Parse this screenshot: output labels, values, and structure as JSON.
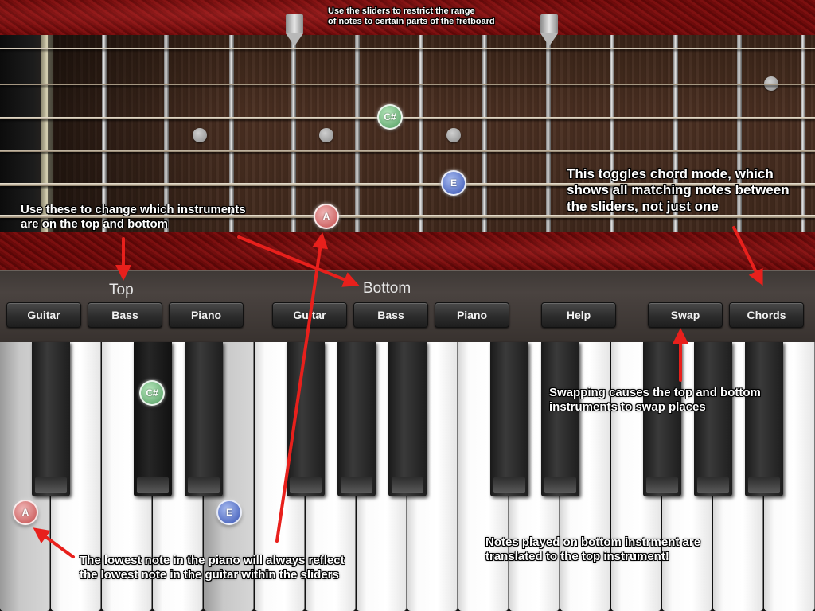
{
  "panel": {
    "top_group_label": "Top",
    "bottom_group_label": "Bottom",
    "top_buttons": [
      "Guitar",
      "Bass",
      "Piano"
    ],
    "bottom_buttons": [
      "Guitar",
      "Bass",
      "Piano"
    ],
    "help_label": "Help",
    "swap_label": "Swap",
    "chords_label": "Chords"
  },
  "notes": {
    "fret_csharp": "C#",
    "fret_e": "E",
    "fret_a": "A",
    "piano_csharp": "C#",
    "piano_e": "E",
    "piano_a": "A"
  },
  "annotations": {
    "sliders_line1": "Use the sliders to restrict the range",
    "sliders_line2": "of notes to certain parts of the fretboard",
    "instruments_line1": "Use these to change which instruments",
    "instruments_line2": "are on the top and bottom",
    "chord_line1": "This toggles chord mode, which",
    "chord_line2": "shows all matching notes between",
    "chord_line3": "the sliders, not just one",
    "swap_line1": "Swapping causes the top and bottom",
    "swap_line2": "instruments to swap places",
    "lowest_line1": "The lowest note in the piano will always reflect",
    "lowest_line2": "the lowest note in the guitar within the sliders",
    "translated_line1": "Notes played on bottom instrment are",
    "translated_line2": "translated to the top instrument!"
  },
  "colors": {
    "annotation_arrow": "#e8201c",
    "velvet": "#6e0b0b",
    "note_green": "#4f9a5e",
    "note_blue": "#3450b0",
    "note_red": "#c24a4a"
  }
}
